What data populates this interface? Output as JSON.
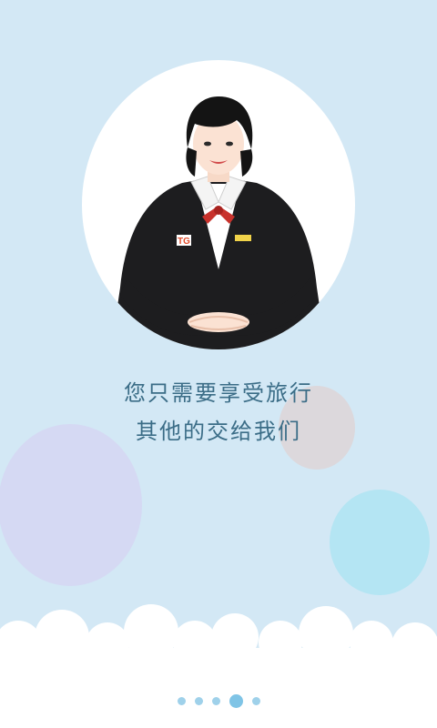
{
  "slogan": {
    "line1": "您只需要享受旅行",
    "line2": "其他的交给我们"
  },
  "portrait": {
    "icon": "hostess-illustration-icon",
    "badge_logo_text": "TG"
  },
  "pager": {
    "count": 5,
    "active_index": 3
  },
  "colors": {
    "background": "#d3e8f5",
    "text": "#3b6d87",
    "dot": "#9fd1ea",
    "dot_active": "#7fc4e6"
  }
}
